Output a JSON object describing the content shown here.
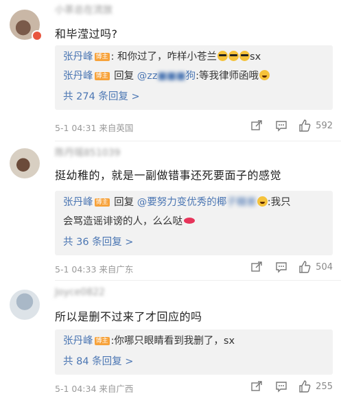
{
  "comments": [
    {
      "username": "小茶总在流放",
      "text": "和毕滢过吗?",
      "replies": [
        {
          "name": "张丹峰",
          "tag": "博主",
          "pre": ":",
          "text": "和你过了，咋样小苍兰",
          "suffix": "sx"
        },
        {
          "name": "张丹峰",
          "tag": "博主",
          "reply_word": "回复",
          "target": "@zz",
          "target_tail": "狗",
          "text": ":等我律师函哦"
        }
      ],
      "more": "共 274 条回复 >",
      "time": "5-1 04:31",
      "location": "来自英国",
      "likes": "592"
    },
    {
      "username": "陈丹瑶851039",
      "text": "挺幼稚的，就是一副做错事还死要面子的感觉",
      "replies": [
        {
          "name": "张丹峰",
          "tag": "博主",
          "reply_word": "回复",
          "target": "@要努力变优秀的椰",
          "target_blur": "子糖崽",
          "text_line1": ":我只",
          "text_line2": "会骂造谣诽谤的人，么么哒"
        }
      ],
      "more": "共 36 条回复 >",
      "time": "5-1 04:33",
      "location": "来自广东",
      "likes": "504"
    },
    {
      "username": "Joyce0822",
      "text": "所以是删不过来了才回应的吗",
      "replies": [
        {
          "name": "张丹峰",
          "tag": "博主",
          "pre": ":",
          "text": "你哪只眼睛看到我删了，sx"
        }
      ],
      "more": "共 84 条回复 >",
      "time": "5-1 04:34",
      "location": "来自广西",
      "likes": "255"
    }
  ],
  "icons": {
    "share": "share-icon",
    "comment": "comment-icon",
    "like": "thumbs-up-icon"
  },
  "colors": {
    "link": "#4b76b3",
    "host_tag": "#f7a23a",
    "reply_bg": "#f2f2f2",
    "meta": "#999999"
  }
}
